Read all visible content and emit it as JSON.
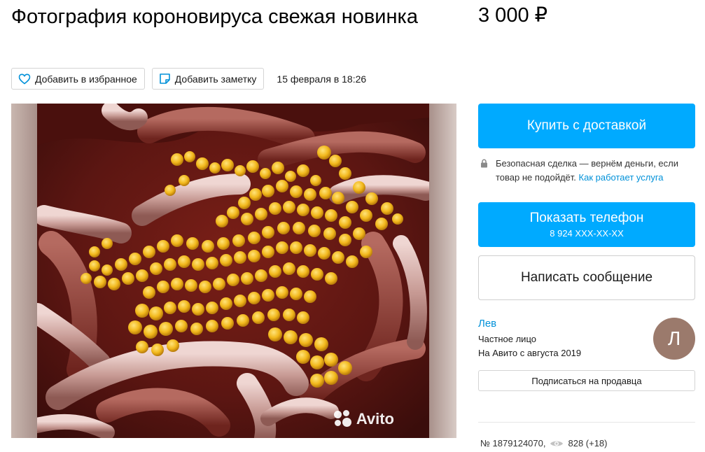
{
  "listing": {
    "title": "Фотография короновируса свежая новинка",
    "price": "3 000 ₽",
    "date": "15 февраля в 18:26",
    "number": "№ 1879124070,",
    "views": "828 (+18)"
  },
  "actions": {
    "favorite_label": "Добавить в избранное",
    "note_label": "Добавить заметку"
  },
  "gallery": {
    "watermark": "Avito"
  },
  "sidebar": {
    "buy_label": "Купить с доставкой",
    "safe_text": "Безопасная сделка — вернём деньги, если товар не подойдёт.",
    "safe_link": "Как работает услуга",
    "phone_label": "Показать телефон",
    "phone_number": "8 924 XXX-XX-XX",
    "message_label": "Написать сообщение",
    "subscribe_label": "Подписаться на продавца"
  },
  "seller": {
    "name": "Лев",
    "type": "Частное лицо",
    "since": "На Авито с августа 2019",
    "avatar_letter": "Л"
  },
  "icons": {
    "favorite": "heart-icon",
    "note": "note-icon",
    "lock": "lock-icon",
    "views": "eye-icon",
    "watermark": "avito-logo-icon"
  },
  "colors": {
    "accent": "#00aaff",
    "link": "#0091d9",
    "avatar_bg": "#9b7a6c"
  }
}
